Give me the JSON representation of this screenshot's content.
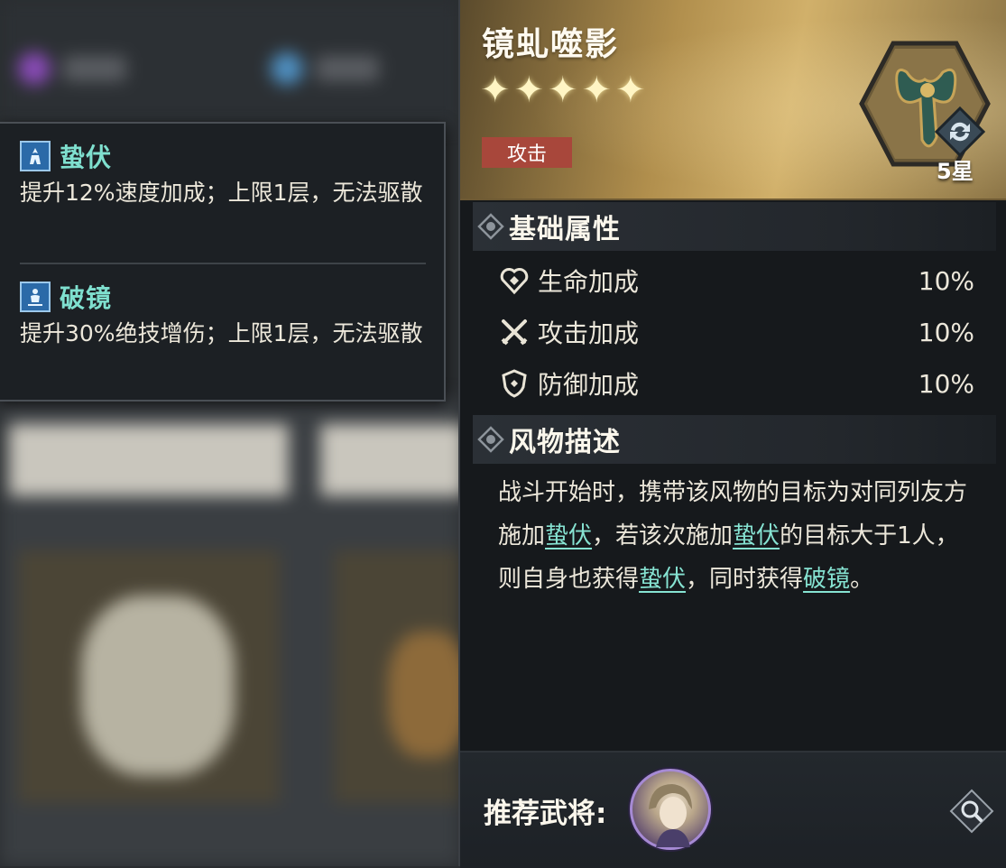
{
  "tooltip": {
    "buffs": [
      {
        "name": "蛰伏",
        "icon": "ambush-buff-icon",
        "description": "提升12%速度加成；上限1层，无法驱散"
      },
      {
        "name": "破镜",
        "icon": "mirror-break-buff-icon",
        "description": "提升30%绝技增伤；上限1层，无法驱散"
      }
    ]
  },
  "item": {
    "name": "镜虬噬影",
    "stars": 5,
    "star_glyph": "✦",
    "type": "攻击",
    "star_level": "5星"
  },
  "basic_attributes": {
    "title": "基础属性",
    "rows": [
      {
        "label": "生命加成",
        "value": "10%",
        "icon": "health-heart-icon"
      },
      {
        "label": "攻击加成",
        "value": "10%",
        "icon": "crossed-swords-icon"
      },
      {
        "label": "防御加成",
        "value": "10%",
        "icon": "shield-icon"
      }
    ]
  },
  "description": {
    "title": "风物描述",
    "parts": [
      {
        "text": "战斗开始时，携带该风物的目标为对同列友方施加"
      },
      {
        "text": "蛰伏",
        "keyword": true
      },
      {
        "text": "，若该次施加"
      },
      {
        "text": "蛰伏",
        "keyword": true
      },
      {
        "text": "的目标大于1人，则自身也获得"
      },
      {
        "text": "蛰伏",
        "keyword": true
      },
      {
        "text": "，同时获得"
      },
      {
        "text": "破镜",
        "keyword": true
      },
      {
        "text": "。"
      }
    ]
  },
  "recommended": {
    "label": "推荐武将:"
  },
  "colors": {
    "keyword": "#86e3d2",
    "type_badge": "#a8473b",
    "buff_name": "#7fe0cf"
  }
}
